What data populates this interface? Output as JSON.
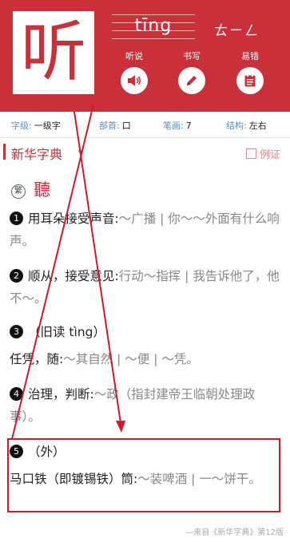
{
  "header": {
    "character": "听",
    "pinyin": "tīng",
    "zhuyin": "ㄊㄧㄥ",
    "buttons": [
      {
        "label": "听说",
        "icon": "speaker-icon"
      },
      {
        "label": "书写",
        "icon": "pencil-icon"
      },
      {
        "label": "易错",
        "icon": "notepad-icon"
      }
    ]
  },
  "info": {
    "level_key": "字级:",
    "level_val": "一级字",
    "radical_key": "部首:",
    "radical_val": "口",
    "strokes_key": "笔画:",
    "strokes_val": "7",
    "structure_key": "结构:",
    "structure_val": "左右"
  },
  "dictionary": {
    "title": "新华字典",
    "caret": "▾",
    "example_label": "例证"
  },
  "traditional": {
    "badge": "繁",
    "char": "聽"
  },
  "definitions": [
    {
      "num": "1",
      "main": "用耳朵接受声音:",
      "ex": "～广播 | 你～～外面有什么响声。"
    },
    {
      "num": "2",
      "main": "顺从，接受意见:",
      "ex": "行动～指挥 | 我告诉他了，他不～。"
    },
    {
      "num": "3",
      "main": "（旧读 tìng）",
      "main2": "任凭，随:",
      "ex": "～其自然 | ～便 | ～凭。"
    },
    {
      "num": "4",
      "main": "治理，判断:",
      "ex": "～政（指封建帝王临朝处理政事）。"
    },
    {
      "num": "5",
      "main": "（外）",
      "main2": "马口铁（即镀锡铁）筒:",
      "ex": "～装啤酒 | 一～饼干。"
    }
  ],
  "footer": "—来自《新华字典》第12版",
  "colors": {
    "brand": "#c9303a",
    "annotation": "#d6172b"
  }
}
